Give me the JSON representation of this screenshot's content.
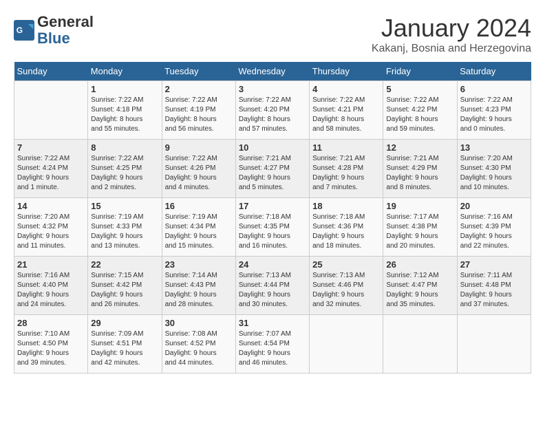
{
  "header": {
    "logo_general": "General",
    "logo_blue": "Blue",
    "month_title": "January 2024",
    "location": "Kakanj, Bosnia and Herzegovina"
  },
  "days_of_week": [
    "Sunday",
    "Monday",
    "Tuesday",
    "Wednesday",
    "Thursday",
    "Friday",
    "Saturday"
  ],
  "weeks": [
    [
      {
        "day": "",
        "info": ""
      },
      {
        "day": "1",
        "info": "Sunrise: 7:22 AM\nSunset: 4:18 PM\nDaylight: 8 hours\nand 55 minutes."
      },
      {
        "day": "2",
        "info": "Sunrise: 7:22 AM\nSunset: 4:19 PM\nDaylight: 8 hours\nand 56 minutes."
      },
      {
        "day": "3",
        "info": "Sunrise: 7:22 AM\nSunset: 4:20 PM\nDaylight: 8 hours\nand 57 minutes."
      },
      {
        "day": "4",
        "info": "Sunrise: 7:22 AM\nSunset: 4:21 PM\nDaylight: 8 hours\nand 58 minutes."
      },
      {
        "day": "5",
        "info": "Sunrise: 7:22 AM\nSunset: 4:22 PM\nDaylight: 8 hours\nand 59 minutes."
      },
      {
        "day": "6",
        "info": "Sunrise: 7:22 AM\nSunset: 4:23 PM\nDaylight: 9 hours\nand 0 minutes."
      }
    ],
    [
      {
        "day": "7",
        "info": "Sunrise: 7:22 AM\nSunset: 4:24 PM\nDaylight: 9 hours\nand 1 minute."
      },
      {
        "day": "8",
        "info": "Sunrise: 7:22 AM\nSunset: 4:25 PM\nDaylight: 9 hours\nand 2 minutes."
      },
      {
        "day": "9",
        "info": "Sunrise: 7:22 AM\nSunset: 4:26 PM\nDaylight: 9 hours\nand 4 minutes."
      },
      {
        "day": "10",
        "info": "Sunrise: 7:21 AM\nSunset: 4:27 PM\nDaylight: 9 hours\nand 5 minutes."
      },
      {
        "day": "11",
        "info": "Sunrise: 7:21 AM\nSunset: 4:28 PM\nDaylight: 9 hours\nand 7 minutes."
      },
      {
        "day": "12",
        "info": "Sunrise: 7:21 AM\nSunset: 4:29 PM\nDaylight: 9 hours\nand 8 minutes."
      },
      {
        "day": "13",
        "info": "Sunrise: 7:20 AM\nSunset: 4:30 PM\nDaylight: 9 hours\nand 10 minutes."
      }
    ],
    [
      {
        "day": "14",
        "info": "Sunrise: 7:20 AM\nSunset: 4:32 PM\nDaylight: 9 hours\nand 11 minutes."
      },
      {
        "day": "15",
        "info": "Sunrise: 7:19 AM\nSunset: 4:33 PM\nDaylight: 9 hours\nand 13 minutes."
      },
      {
        "day": "16",
        "info": "Sunrise: 7:19 AM\nSunset: 4:34 PM\nDaylight: 9 hours\nand 15 minutes."
      },
      {
        "day": "17",
        "info": "Sunrise: 7:18 AM\nSunset: 4:35 PM\nDaylight: 9 hours\nand 16 minutes."
      },
      {
        "day": "18",
        "info": "Sunrise: 7:18 AM\nSunset: 4:36 PM\nDaylight: 9 hours\nand 18 minutes."
      },
      {
        "day": "19",
        "info": "Sunrise: 7:17 AM\nSunset: 4:38 PM\nDaylight: 9 hours\nand 20 minutes."
      },
      {
        "day": "20",
        "info": "Sunrise: 7:16 AM\nSunset: 4:39 PM\nDaylight: 9 hours\nand 22 minutes."
      }
    ],
    [
      {
        "day": "21",
        "info": "Sunrise: 7:16 AM\nSunset: 4:40 PM\nDaylight: 9 hours\nand 24 minutes."
      },
      {
        "day": "22",
        "info": "Sunrise: 7:15 AM\nSunset: 4:42 PM\nDaylight: 9 hours\nand 26 minutes."
      },
      {
        "day": "23",
        "info": "Sunrise: 7:14 AM\nSunset: 4:43 PM\nDaylight: 9 hours\nand 28 minutes."
      },
      {
        "day": "24",
        "info": "Sunrise: 7:13 AM\nSunset: 4:44 PM\nDaylight: 9 hours\nand 30 minutes."
      },
      {
        "day": "25",
        "info": "Sunrise: 7:13 AM\nSunset: 4:46 PM\nDaylight: 9 hours\nand 32 minutes."
      },
      {
        "day": "26",
        "info": "Sunrise: 7:12 AM\nSunset: 4:47 PM\nDaylight: 9 hours\nand 35 minutes."
      },
      {
        "day": "27",
        "info": "Sunrise: 7:11 AM\nSunset: 4:48 PM\nDaylight: 9 hours\nand 37 minutes."
      }
    ],
    [
      {
        "day": "28",
        "info": "Sunrise: 7:10 AM\nSunset: 4:50 PM\nDaylight: 9 hours\nand 39 minutes."
      },
      {
        "day": "29",
        "info": "Sunrise: 7:09 AM\nSunset: 4:51 PM\nDaylight: 9 hours\nand 42 minutes."
      },
      {
        "day": "30",
        "info": "Sunrise: 7:08 AM\nSunset: 4:52 PM\nDaylight: 9 hours\nand 44 minutes."
      },
      {
        "day": "31",
        "info": "Sunrise: 7:07 AM\nSunset: 4:54 PM\nDaylight: 9 hours\nand 46 minutes."
      },
      {
        "day": "",
        "info": ""
      },
      {
        "day": "",
        "info": ""
      },
      {
        "day": "",
        "info": ""
      }
    ]
  ]
}
